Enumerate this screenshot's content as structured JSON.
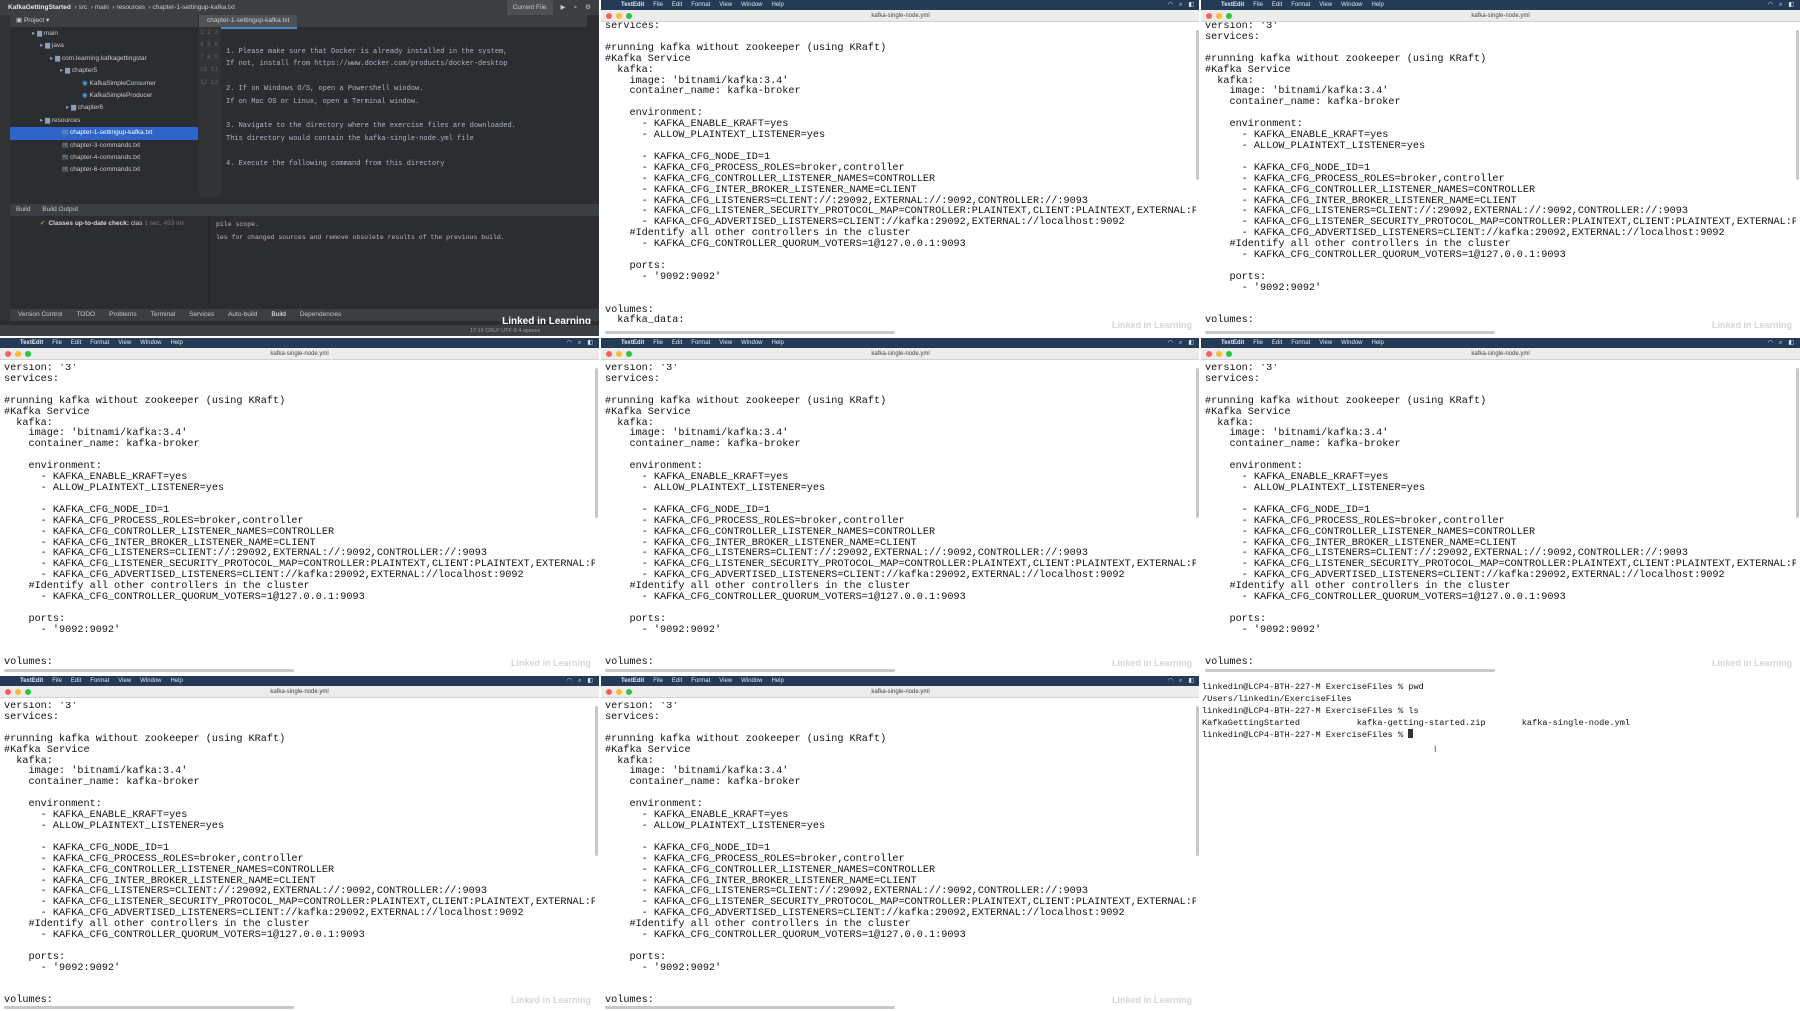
{
  "ide": {
    "project_name": "KafkaGettingStarted",
    "breadcrumb": [
      "src",
      "main",
      "resources",
      "chapter-1-settingup-kafka.txt"
    ],
    "run_config": "Current File",
    "project_label": "Project",
    "tree": [
      {
        "label": "main",
        "indent": 22
      },
      {
        "label": "java",
        "indent": 30
      },
      {
        "label": "com.learning.kafkagettingstar",
        "indent": 40
      },
      {
        "label": "chapter5",
        "indent": 50
      },
      {
        "label": "KafkaSimpleConsumer",
        "indent": 72
      },
      {
        "label": "KafkaSimpleProducer",
        "indent": 72
      },
      {
        "label": "chapter6",
        "indent": 56
      },
      {
        "label": "resources",
        "indent": 30
      },
      {
        "label": "chapter-1-settingup-kafka.txt",
        "indent": 52,
        "selected": true
      },
      {
        "label": "chapter-3-commands.txt",
        "indent": 52
      },
      {
        "label": "chapter-4-commands.txt",
        "indent": 52
      },
      {
        "label": "chapter-6-commands.txt",
        "indent": 52
      }
    ],
    "editor_tab": "chapter-1-settingup-kafka.txt",
    "gutter": "1\n2\n3\n4\n5\n6\n7\n8\n9\n10\n11\n12\n13",
    "editor_text": "1. Please make sure that Docker is already installed in the system,\nIf not, install from https://www.docker.com/products/docker-desktop\n\n2. If on Windows O/S, open a Powershell window.\nIf on Mac OS or Linux, open a Terminal window.\n\n3. Navigate to the directory where the exercise files are downloaded.\nThis directory would contain the kafka-single-node.yml file\n\n4. Execute the following command from this directory",
    "build_tabs": [
      "Build",
      "Build Output"
    ],
    "build_item": "Classes up-to-date check:",
    "build_item_suffix": "clas",
    "build_time": "1 sec, 453 ms",
    "build_output": "pile scope.\nles for changed sources and remove obsolete results of the previous build.",
    "bottom_tabs": [
      "Version Control",
      "TODO",
      "Problems",
      "Terminal",
      "Services",
      "Auto-build",
      "Build",
      "Dependencies"
    ],
    "status": "17:16   CRLF   UTF-8   4 spaces",
    "watermark": "Linked in Learning"
  },
  "textedit": {
    "app": "TextEdit",
    "menus": [
      "File",
      "Edit",
      "Format",
      "View",
      "Window",
      "Help"
    ],
    "file_title": "kafka-single-node.yml",
    "watermark": "Linked in Learning",
    "yaml_full": "version: '3'\nservices:\n\n#running kafka without zookeeper (using KRaft)\n#Kafka Service\n  kafka:\n    image: 'bitnami/kafka:3.4'\n    container_name: kafka-broker\n\n    environment:\n      - KAFKA_ENABLE_KRAFT=yes\n      - ALLOW_PLAINTEXT_LISTENER=yes\n\n      - KAFKA_CFG_NODE_ID=1\n      - KAFKA_CFG_PROCESS_ROLES=broker,controller\n      - KAFKA_CFG_CONTROLLER_LISTENER_NAMES=CONTROLLER\n      - KAFKA_CFG_INTER_BROKER_LISTENER_NAME=CLIENT\n      - KAFKA_CFG_LISTENERS=CLIENT://:29092,EXTERNAL://:9092,CONTROLLER://:9093\n      - KAFKA_CFG_LISTENER_SECURITY_PROTOCOL_MAP=CONTROLLER:PLAINTEXT,CLIENT:PLAINTEXT,EXTERNAL:PLAINTEXT\n      - KAFKA_CFG_ADVERTISED_LISTENERS=CLIENT://kafka:29092,EXTERNAL://localhost:9092\n    #Identify all other controllers in the cluster\n      - KAFKA_CFG_CONTROLLER_QUORUM_VOTERS=1@127.0.0.1:9093\n\n    ports:\n      - '9092:9092'\n\n\nvolumes:",
    "yaml_scrolled": "services:\n\n#running kafka without zookeeper (using KRaft)\n#Kafka Service\n  kafka:\n    image: 'bitnami/kafka:3.4'\n    container_name: kafka-broker\n\n    environment:\n      - KAFKA_ENABLE_KRAFT=yes\n      - ALLOW_PLAINTEXT_LISTENER=yes\n\n      - KAFKA_CFG_NODE_ID=1\n      - KAFKA_CFG_PROCESS_ROLES=broker,controller\n      - KAFKA_CFG_CONTROLLER_LISTENER_NAMES=CONTROLLER\n      - KAFKA_CFG_INTER_BROKER_LISTENER_NAME=CLIENT\n      - KAFKA_CFG_LISTENERS=CLIENT://:29092,EXTERNAL://:9092,CONTROLLER://:9093\n      - KAFKA_CFG_LISTENER_SECURITY_PROTOCOL_MAP=CONTROLLER:PLAINTEXT,CLIENT:PLAINTEXT,EXTERNAL:PLAINTEXT\n      - KAFKA_CFG_ADVERTISED_LISTENERS=CLIENT://kafka:29092,EXTERNAL://localhost:9092\n    #Identify all other controllers in the cluster\n      - KAFKA_CFG_CONTROLLER_QUORUM_VOTERS=1@127.0.0.1:9093\n\n    ports:\n      - '9092:9092'\n\n\nvolumes:\n  kafka_data:"
  },
  "terminal": {
    "lines": "linkedin@LCP4-BTH-227-M ExerciseFiles % pwd\n/Users/linkedin/ExerciseFiles\nlinkedin@LCP4-BTH-227-M ExerciseFiles % ls\nKafkaGettingStarted           kafka-getting-started.zip       kafka-single-node.yml\nlinkedin@LCP4-BTH-227-M ExerciseFiles % "
  }
}
